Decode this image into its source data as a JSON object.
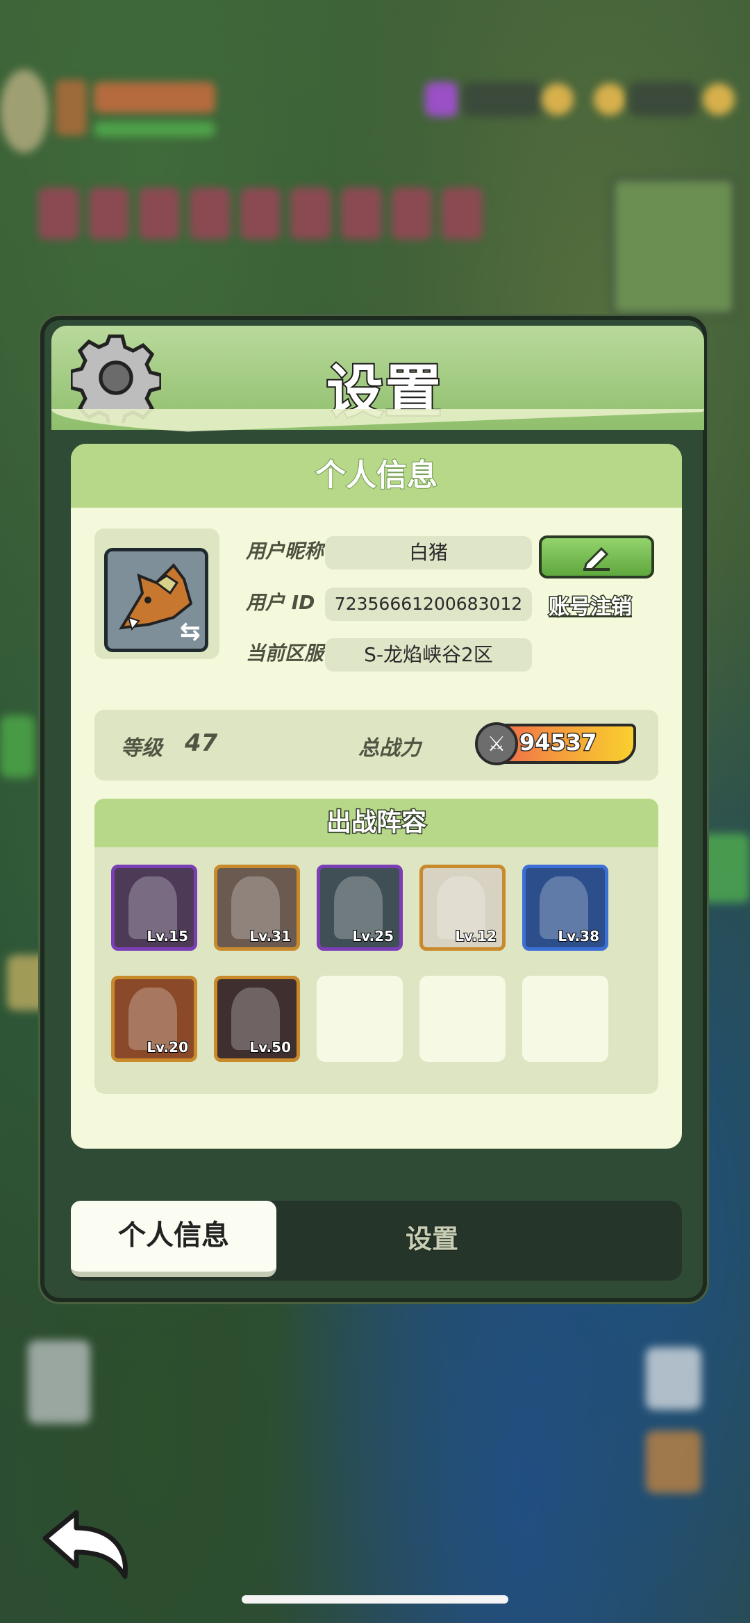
{
  "panel": {
    "title": "设置",
    "info_header": "个人信息",
    "nickname_label": "用户昵称",
    "nickname": "白猪",
    "id_label": "用户 ID",
    "user_id": "72356661200683012",
    "delete_account": "账号注销",
    "server_label": "当前区服",
    "server": "S-龙焰峡谷2区",
    "level_label": "等级",
    "level": "47",
    "power_label": "总战力",
    "power": "94537",
    "team_header": "出战阵容",
    "heroes": [
      {
        "level": "Lv.15",
        "color": "#7b3fb5",
        "bg": "#4c3a57"
      },
      {
        "level": "Lv.31",
        "color": "#c98a2c",
        "bg": "#6a5a50"
      },
      {
        "level": "Lv.25",
        "color": "#7b3fb5",
        "bg": "#3f4f55"
      },
      {
        "level": "Lv.12",
        "color": "#c98a2c",
        "bg": "#d8d2c2"
      },
      {
        "level": "Lv.38",
        "color": "#3c6fd6",
        "bg": "#2c4f8c"
      },
      {
        "level": "Lv.20",
        "color": "#c98a2c",
        "bg": "#8a4a2a"
      },
      {
        "level": "Lv.50",
        "color": "#c98a2c",
        "bg": "#3f2f2f"
      }
    ]
  },
  "tabs": {
    "personal": "个人信息",
    "settings": "设置"
  }
}
